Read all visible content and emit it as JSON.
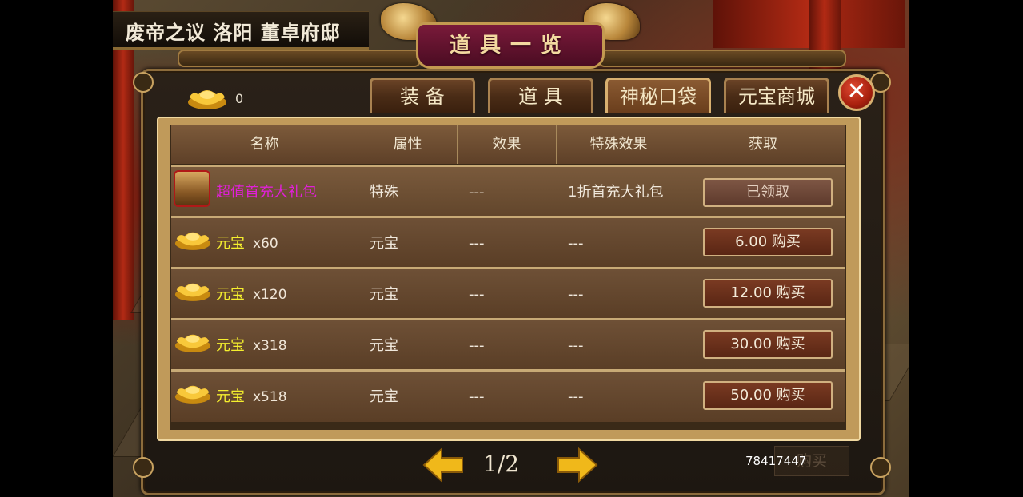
{
  "location": {
    "text": "废帝之议 洛阳  董卓府邸"
  },
  "title": "道具一览",
  "gold": {
    "icon": "gold-ingot-icon",
    "count": "0"
  },
  "tabs": [
    {
      "label": "装 备",
      "active": false
    },
    {
      "label": "道 具",
      "active": false
    },
    {
      "label": "神秘口袋",
      "active": true
    },
    {
      "label": "元宝商城",
      "active": false
    }
  ],
  "close": {
    "icon": "close-icon",
    "label": "✕"
  },
  "table": {
    "headers": [
      "名称",
      "属性",
      "效果",
      "特殊效果",
      "获取"
    ],
    "rows": [
      {
        "icon": "treasure-chest-icon",
        "name": "超值首充大礼包",
        "qty": "",
        "attr": "特殊",
        "effect": "---",
        "special": "1折首充大礼包",
        "action": "已领取",
        "claimed": true
      },
      {
        "icon": "gold-ingot-icon",
        "name": "元宝",
        "qty": "x60",
        "attr": "元宝",
        "effect": "---",
        "special": "---",
        "action": "6.00 购买",
        "claimed": false
      },
      {
        "icon": "gold-ingot-icon",
        "name": "元宝",
        "qty": "x120",
        "attr": "元宝",
        "effect": "---",
        "special": "---",
        "action": "12.00 购买",
        "claimed": false
      },
      {
        "icon": "gold-ingot-icon",
        "name": "元宝",
        "qty": "x318",
        "attr": "元宝",
        "effect": "---",
        "special": "---",
        "action": "30.00 购买",
        "claimed": false
      },
      {
        "icon": "gold-ingot-icon",
        "name": "元宝",
        "qty": "x518",
        "attr": "元宝",
        "effect": "---",
        "special": "---",
        "action": "50.00 购买",
        "claimed": false
      }
    ]
  },
  "pager": {
    "text": "1/2",
    "prev_icon": "arrow-left-icon",
    "next_icon": "arrow-right-icon"
  },
  "footer": {
    "user_id": "78417447",
    "buy_label": "购买"
  },
  "colors": {
    "item_name": "#f5ef2e",
    "gift_name": "#e020d8",
    "frame_gold": "#c8a260",
    "button": "#5a2614"
  }
}
